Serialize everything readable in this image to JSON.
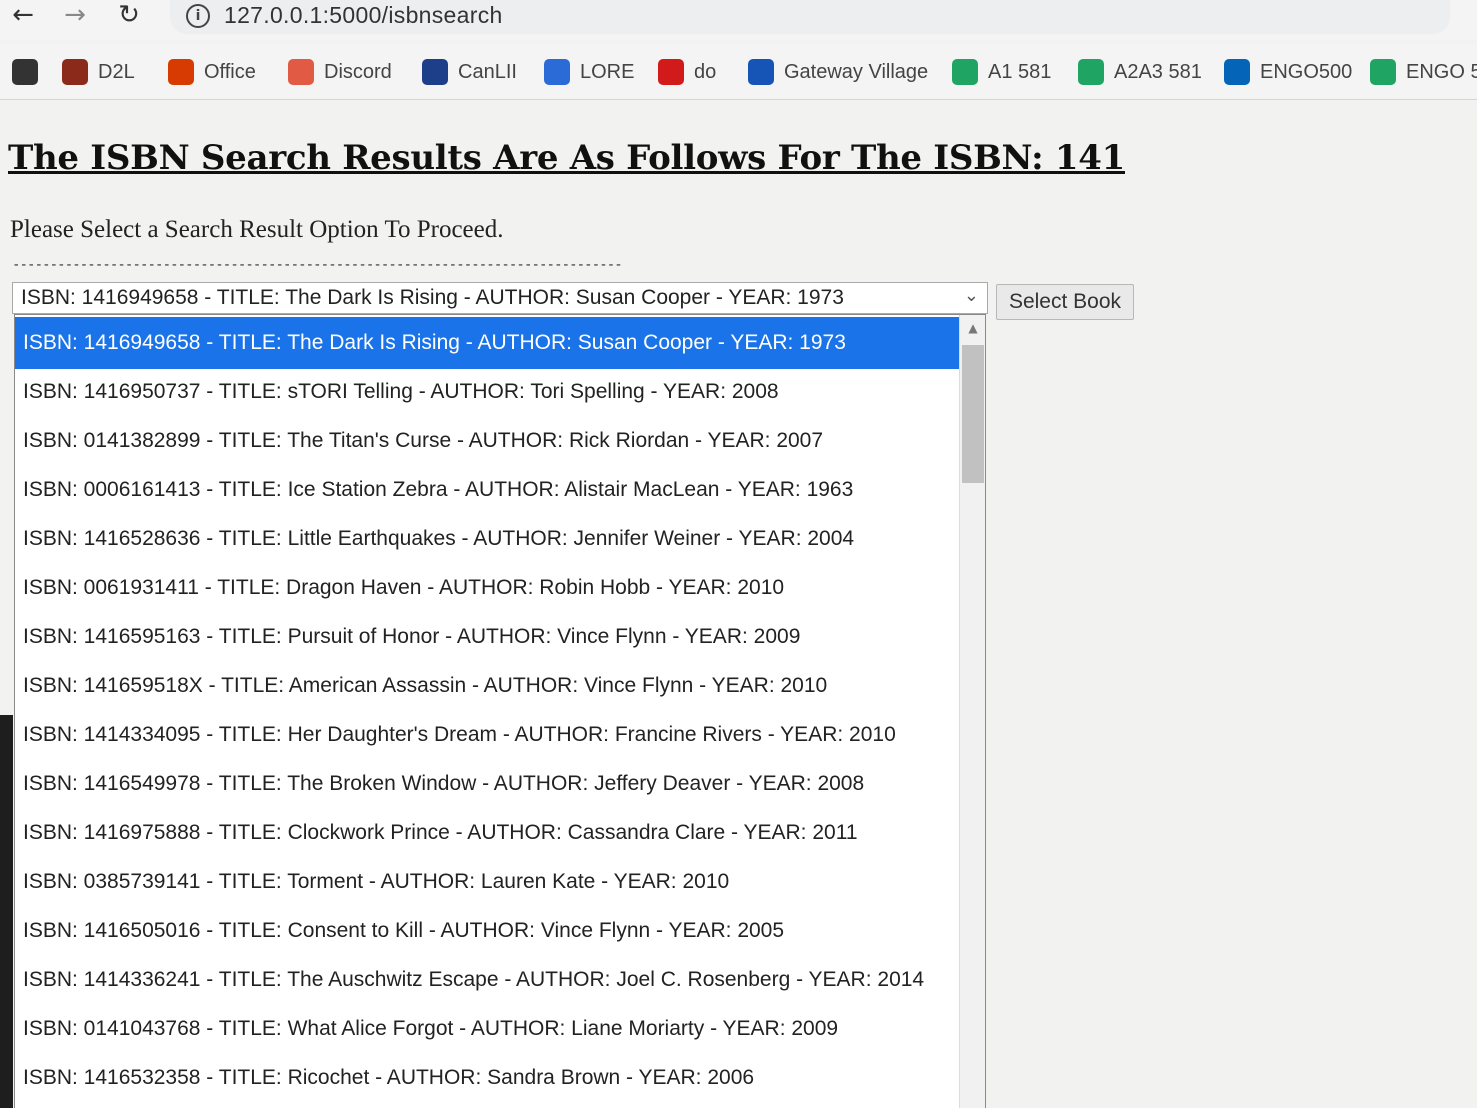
{
  "browser": {
    "url": "127.0.0.1:5000/isbnsearch",
    "bookmarks": [
      {
        "label": "",
        "icon": "globe-icon",
        "color": "#333333"
      },
      {
        "label": "D2L",
        "icon": "shield-icon",
        "color": "#8b2a1a"
      },
      {
        "label": "Office",
        "icon": "office-icon",
        "color": "#d83b01"
      },
      {
        "label": "Discord",
        "icon": "discord-icon",
        "color": "#e05a44"
      },
      {
        "label": "CanLII",
        "icon": "canlii-icon",
        "color": "#1d3f8a"
      },
      {
        "label": "LORE",
        "icon": "doc-icon",
        "color": "#2b6bd8"
      },
      {
        "label": "do",
        "icon": "cbc-icon",
        "color": "#d31a1a"
      },
      {
        "label": "Gateway Village",
        "icon": "gateway-icon",
        "color": "#1655b5"
      },
      {
        "label": "A1 581",
        "icon": "drive-icon",
        "color": "#1fa463"
      },
      {
        "label": "A2A3 581",
        "icon": "drive-icon",
        "color": "#1fa463"
      },
      {
        "label": "ENGO500",
        "icon": "onedrive-icon",
        "color": "#0364b8"
      },
      {
        "label": "ENGO 5",
        "icon": "drive-icon",
        "color": "#1fa463"
      }
    ]
  },
  "page": {
    "title": "The ISBN Search Results Are As Follows For The ISBN: 141",
    "subtitle": "Please Select a Search Result Option To Proceed.",
    "divider": "---------------------------------------------------------------------------------"
  },
  "select": {
    "current_value": "ISBN: 1416949658 - TITLE: The Dark Is Rising - AUTHOR: Susan Cooper - YEAR: 1973",
    "button_label": "Select Book",
    "options": [
      "ISBN: 1416949658 - TITLE: The Dark Is Rising - AUTHOR: Susan Cooper - YEAR: 1973",
      "ISBN: 1416950737 - TITLE: sTORI Telling - AUTHOR: Tori Spelling - YEAR: 2008",
      "ISBN: 0141382899 - TITLE: The Titan's Curse - AUTHOR: Rick Riordan - YEAR: 2007",
      "ISBN: 0006161413 - TITLE: Ice Station Zebra - AUTHOR: Alistair MacLean - YEAR: 1963",
      "ISBN: 1416528636 - TITLE: Little Earthquakes - AUTHOR: Jennifer Weiner - YEAR: 2004",
      "ISBN: 0061931411 - TITLE: Dragon Haven - AUTHOR: Robin Hobb - YEAR: 2010",
      "ISBN: 1416595163 - TITLE: Pursuit of Honor - AUTHOR: Vince Flynn - YEAR: 2009",
      "ISBN: 141659518X - TITLE: American Assassin - AUTHOR: Vince Flynn - YEAR: 2010",
      "ISBN: 1414334095 - TITLE: Her Daughter's Dream - AUTHOR: Francine Rivers - YEAR: 2010",
      "ISBN: 1416549978 - TITLE: The Broken Window - AUTHOR: Jeffery Deaver - YEAR: 2008",
      "ISBN: 1416975888 - TITLE: Clockwork Prince - AUTHOR: Cassandra Clare - YEAR: 2011",
      "ISBN: 0385739141 - TITLE: Torment - AUTHOR: Lauren Kate - YEAR: 2010",
      "ISBN: 1416505016 - TITLE: Consent to Kill - AUTHOR: Vince Flynn - YEAR: 2005",
      "ISBN: 1414336241 - TITLE: The Auschwitz Escape - AUTHOR: Joel C. Rosenberg - YEAR: 2014",
      "ISBN: 0141043768 - TITLE: What Alice Forgot - AUTHOR: Liane Moriarty - YEAR: 2009",
      "ISBN: 1416532358 - TITLE: Ricochet - AUTHOR: Sandra Brown - YEAR: 2006"
    ],
    "selected_index": 0
  },
  "colors": {
    "highlight": "#1a73e8"
  }
}
